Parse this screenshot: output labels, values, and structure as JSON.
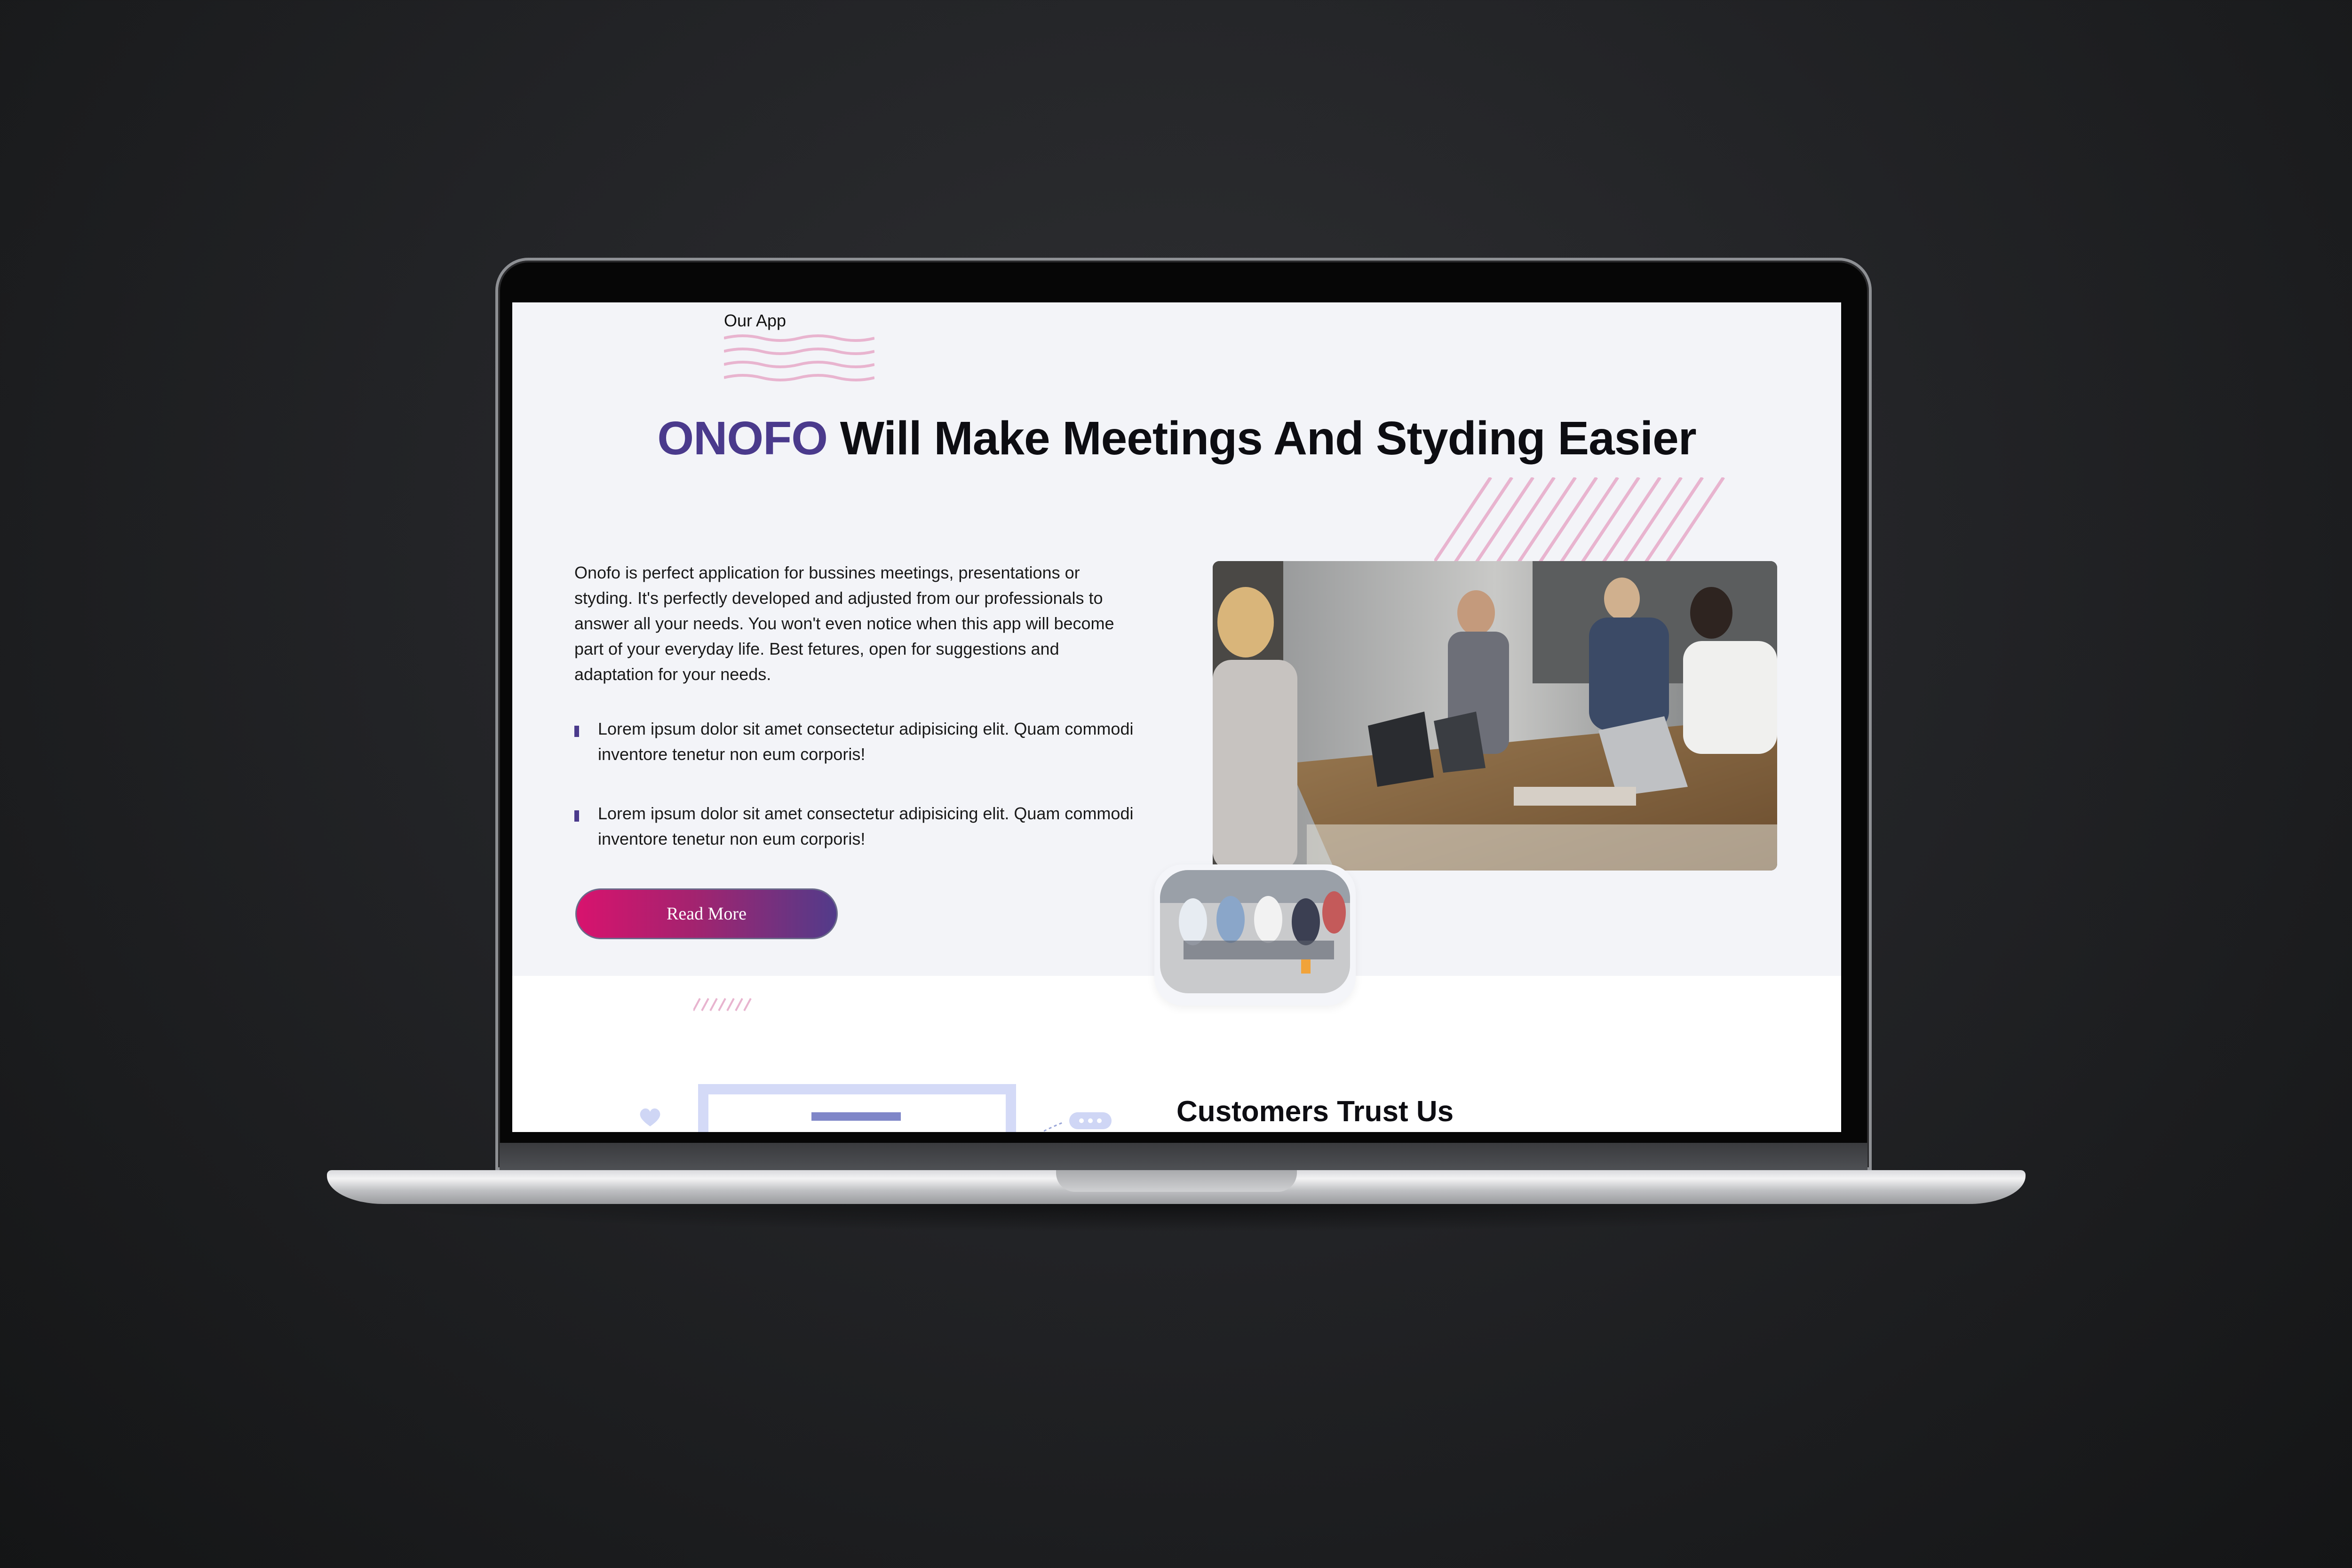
{
  "section": {
    "label": "Our App"
  },
  "hero": {
    "brand": "ONOFO",
    "title_rest": " Will Make Meetings And Styding Easier"
  },
  "intro": {
    "text": "Onofo is perfect application for bussines meetings, presentations or styding. It's perfectly developed and adjusted from our professionals to answer all your needs. You won't even notice when this app will become part of your everyday life. Best fetures, open for suggestions and adaptation for your needs."
  },
  "bullets": [
    {
      "text": "Lorem ipsum dolor sit amet consectetur adipisicing elit. Quam commodi inventore tenetur non eum corporis!"
    },
    {
      "text": "Lorem ipsum dolor sit amet consectetur adipisicing elit. Quam commodi inventore tenetur non eum corporis!"
    }
  ],
  "cta": {
    "read_more": "Read More"
  },
  "customers": {
    "title": "Customers Trust Us"
  },
  "colors": {
    "brand": "#4a3a8c",
    "accent_pink": "#d8136e",
    "decor_pink": "#e8b4cf",
    "page_bg": "#f3f4f8"
  },
  "icons": [
    "wave-decoration-icon",
    "stripe-decoration-icon",
    "heart-icon",
    "chat-bubble-icon"
  ]
}
